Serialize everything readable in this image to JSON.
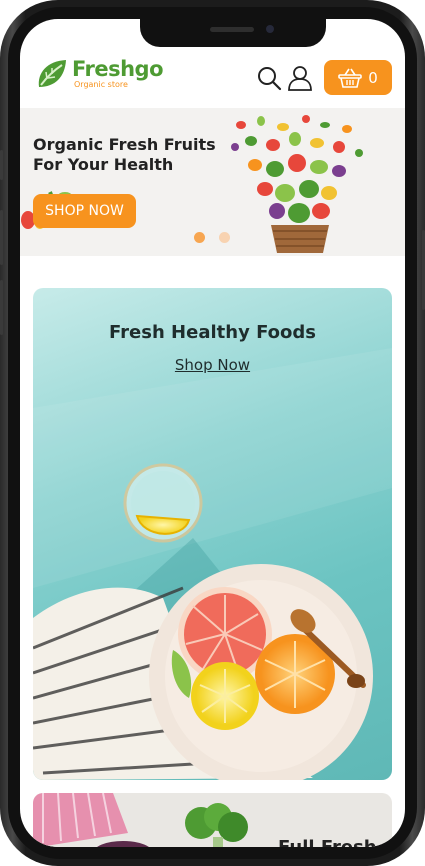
{
  "header": {
    "brand": "Freshgo",
    "tagline": "Organic store",
    "search_icon": "search-icon",
    "account_icon": "user-icon",
    "cart": {
      "icon": "basket-icon",
      "count": "0"
    }
  },
  "hero": {
    "title_line1": "Organic Fresh Fruits",
    "title_line2": "For Your Health",
    "button": "SHOP NOW",
    "slides": 2,
    "active_slide": 1
  },
  "promo": {
    "title": "Fresh Healthy Foods",
    "link": "Shop Now"
  },
  "next_card": {
    "title": "Full Fresh"
  },
  "colors": {
    "accent": "#f7931e",
    "brand_green": "#4e9b33",
    "promo_bg": "#6cc4c2",
    "hero_bg": "#f3f2f0"
  }
}
